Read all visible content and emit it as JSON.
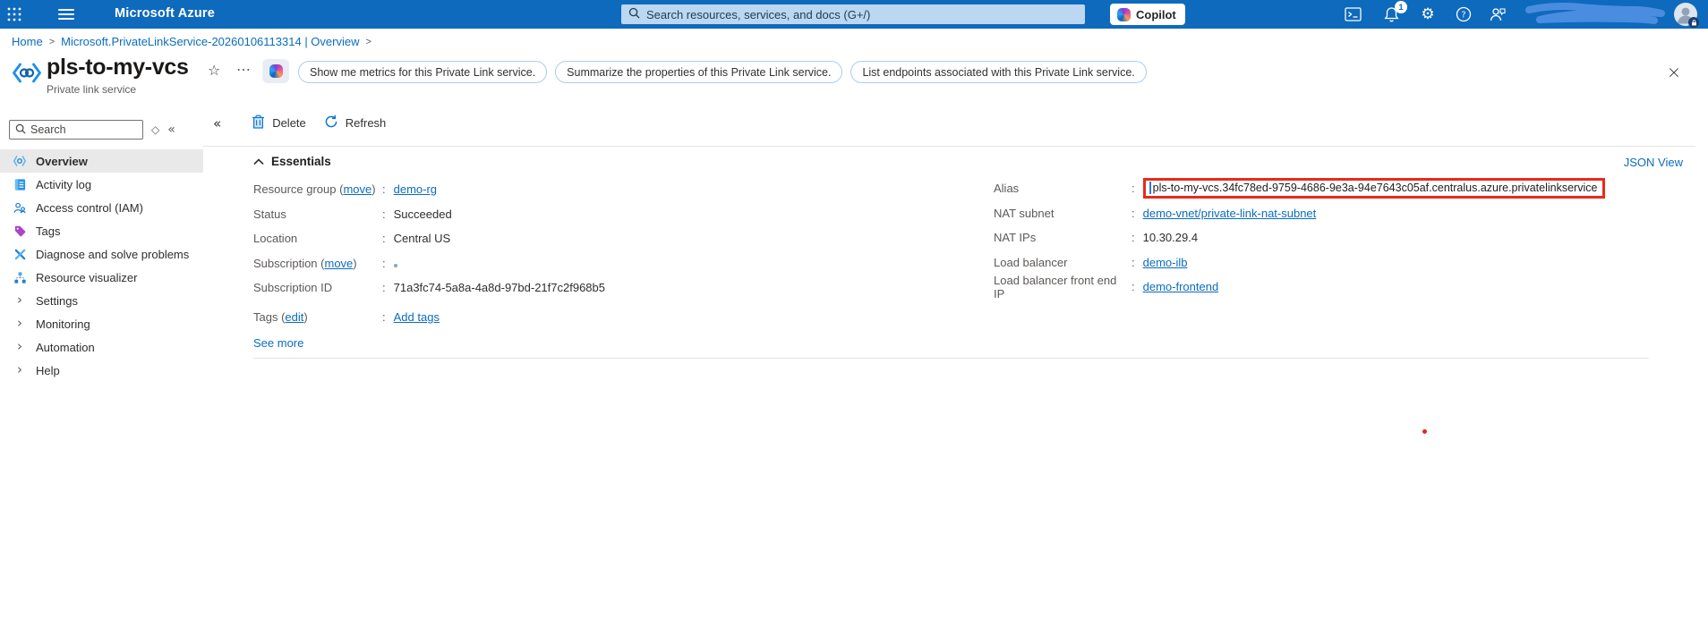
{
  "colors": {
    "topbar": "#0e6abd",
    "link": "#0b6cbe",
    "highlight_red": "#ea2a1a",
    "selected_bg": "#e9e9e9"
  },
  "glyphs": {
    "star": "☆",
    "ellipsis": "…",
    "sidebar_collapse": "«",
    "sidebar_sort": "◇",
    "close": "×",
    "breadcrumb_sep": ">",
    "chevron_right": "›",
    "gear": "⚙"
  },
  "topbar": {
    "title": "Microsoft Azure",
    "search_placeholder": "Search resources, services, and docs (G+/)",
    "copilot_label": "Copilot",
    "notification_count": "1"
  },
  "breadcrumb": {
    "items": [
      {
        "label": "Home"
      },
      {
        "label": "Microsoft.PrivateLinkService-20260106113314 | Overview"
      }
    ]
  },
  "header": {
    "title": "pls-to-my-vcs",
    "subtitle": "Private link service",
    "chips": [
      "Show me metrics for this Private Link service.",
      "Summarize the properties of this Private Link service.",
      "List endpoints associated with this Private Link service."
    ]
  },
  "sidebar": {
    "search_placeholder": "Search",
    "items": [
      {
        "label": "Overview"
      },
      {
        "label": "Activity log"
      },
      {
        "label": "Access control (IAM)"
      },
      {
        "label": "Tags"
      },
      {
        "label": "Diagnose and solve problems"
      },
      {
        "label": "Resource visualizer"
      },
      {
        "label": "Settings"
      },
      {
        "label": "Monitoring"
      },
      {
        "label": "Automation"
      },
      {
        "label": "Help"
      }
    ]
  },
  "commandbar": {
    "delete_label": "Delete",
    "refresh_label": "Refresh"
  },
  "essentials": {
    "title": "Essentials",
    "json_view": "JSON View",
    "see_more": "See more",
    "left": [
      {
        "label_pre": "Resource group (",
        "label_link": "move",
        "label_post": ")",
        "value": "demo-rg"
      },
      {
        "label_pre": "Status",
        "label_link": "",
        "label_post": "",
        "value": "Succeeded"
      },
      {
        "label_pre": "Location",
        "label_link": "",
        "label_post": "",
        "value": "Central US"
      },
      {
        "label_pre": "Subscription (",
        "label_link": "move",
        "label_post": ")",
        "value": ""
      },
      {
        "label_pre": "Subscription ID",
        "label_link": "",
        "label_post": "",
        "value": "71a3fc74-5a8a-4a8d-97bd-21f7c2f968b5"
      },
      {
        "label_pre": "Tags (",
        "label_link": "edit",
        "label_post": ")",
        "value": "Add tags"
      }
    ],
    "right": [
      {
        "label": "Alias",
        "value": "pls-to-my-vcs.34fc78ed-9759-4686-9e3a-94e7643c05af.centralus.azure.privatelinkservice"
      },
      {
        "label": "NAT subnet",
        "value": "demo-vnet/private-link-nat-subnet"
      },
      {
        "label": "NAT IPs",
        "value": "10.30.29.4"
      },
      {
        "label": "Load balancer",
        "value": "demo-ilb"
      },
      {
        "label": "Load balancer front end IP",
        "value": "demo-frontend"
      }
    ]
  }
}
